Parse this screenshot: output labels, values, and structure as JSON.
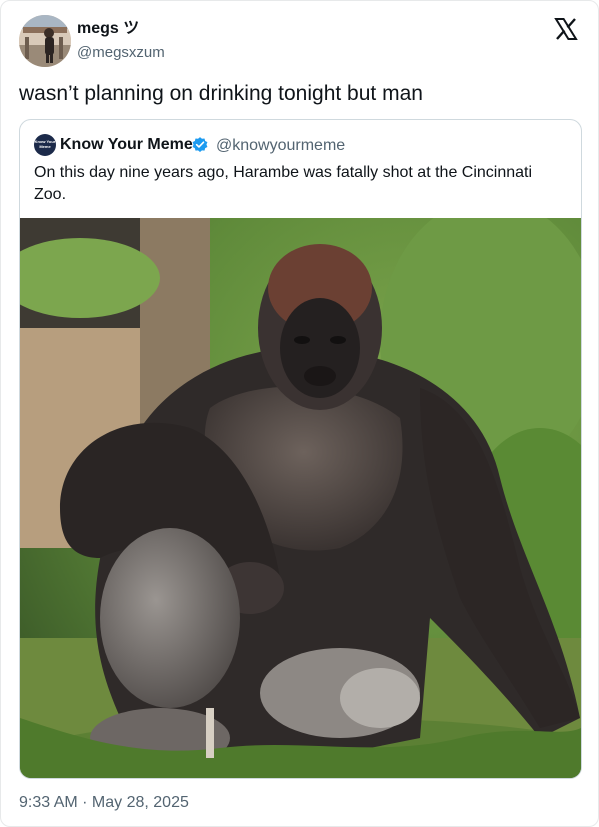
{
  "author": {
    "display_name": "megs ツ",
    "handle": "@megsxzum"
  },
  "tweet": {
    "text": "wasn’t planning on drinking tonight but man",
    "timestamp": "9:33 AM · May 28, 2025"
  },
  "quoted": {
    "display_name": "Know Your Meme",
    "handle": "@knowyourmeme",
    "avatar_text": "Know Your Meme",
    "verified": true,
    "text": "On this day nine years ago, Harambe was fatally shot at the Cincinnati Zoo.",
    "image_subject": "gorilla"
  },
  "icons": {
    "platform_logo": "x-logo-icon",
    "verified_badge": "verified-badge-icon"
  },
  "colors": {
    "text_primary": "#0f1419",
    "text_secondary": "#536471",
    "verified_blue": "#1d9bf0",
    "border": "#cfd9de"
  }
}
